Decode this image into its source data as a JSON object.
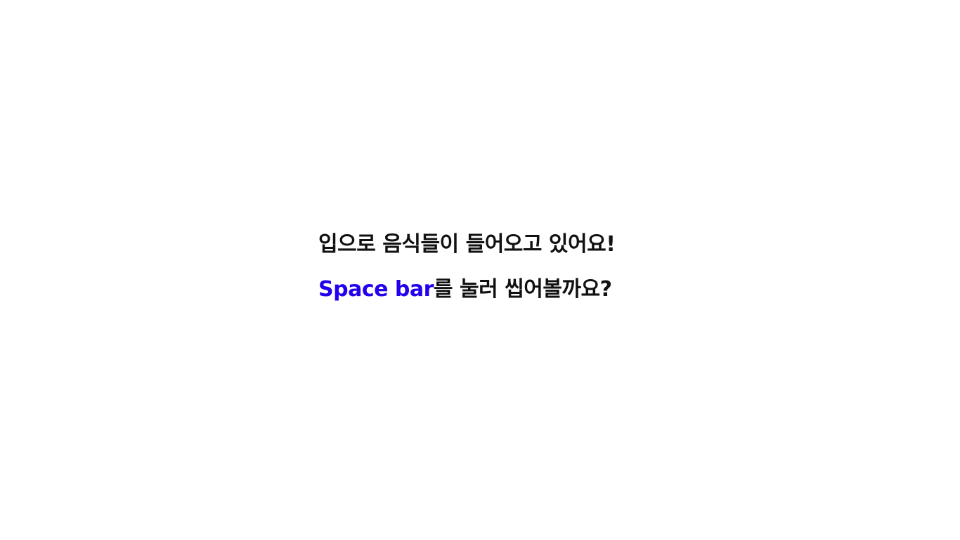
{
  "message": {
    "line1": "입으로 음식들이 들어오고 있어요!",
    "line2_key": "Space bar",
    "line2_rest": "를 눌러 씹어볼까요?"
  },
  "colors": {
    "text": "#111111",
    "key_highlight": "#2200ee",
    "background": "#ffffff"
  }
}
